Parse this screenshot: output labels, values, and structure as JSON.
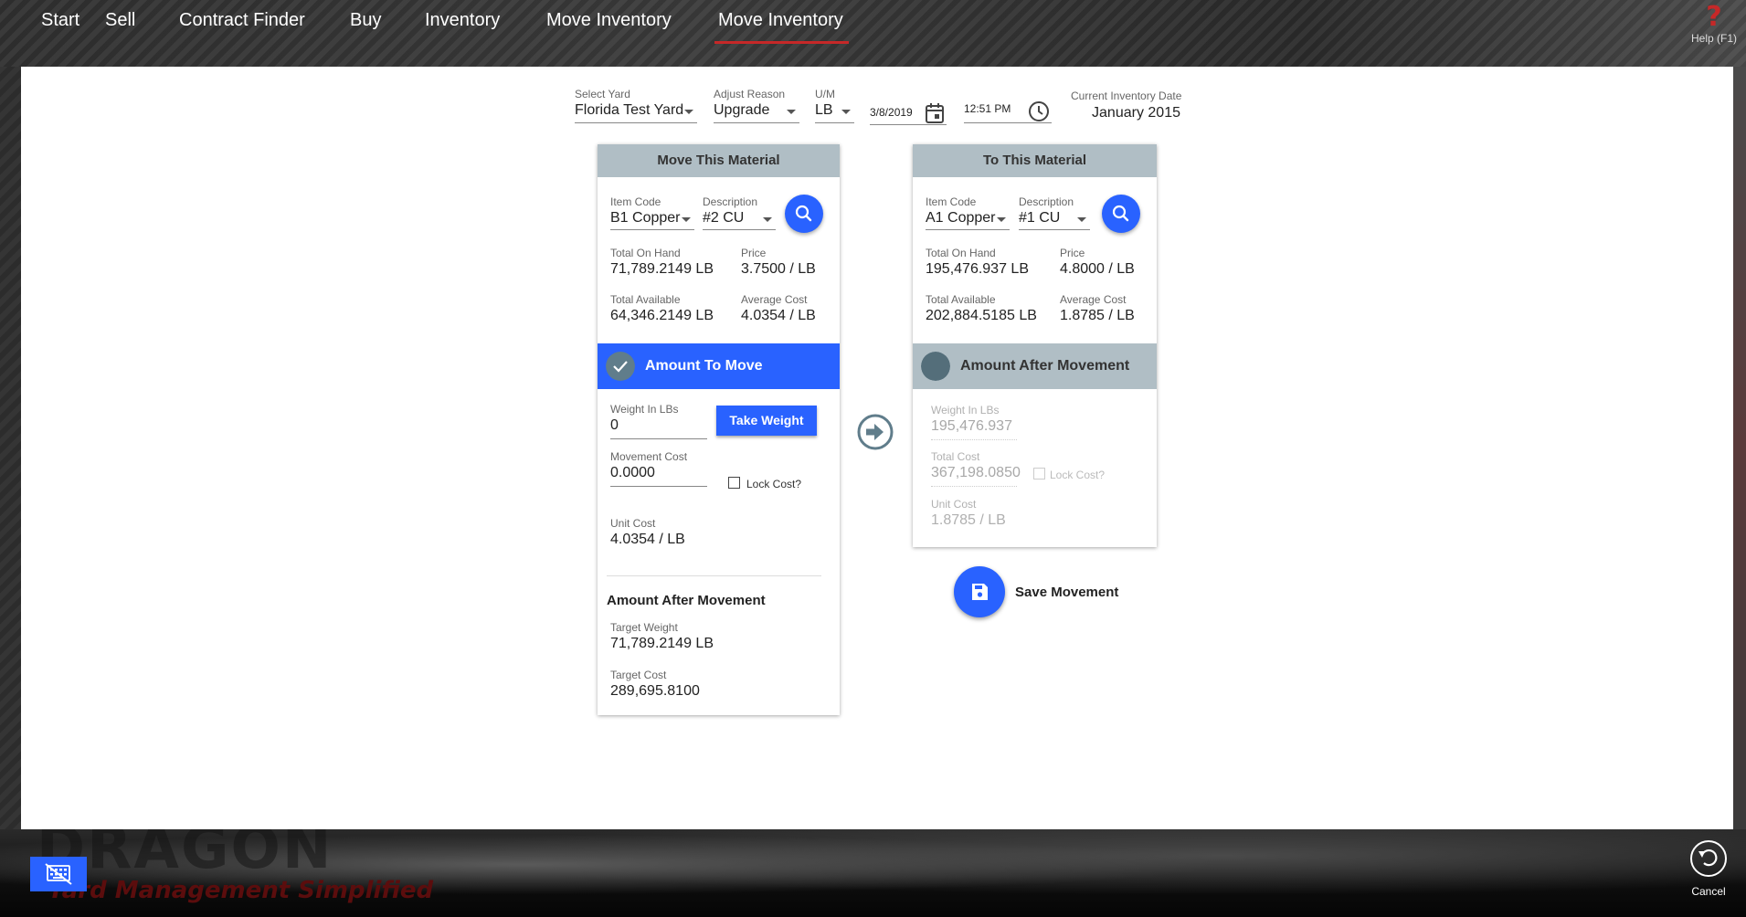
{
  "nav": {
    "items": [
      "Start",
      "Sell",
      "Contract Finder",
      "Buy",
      "Inventory",
      "Move Inventory",
      "Move Inventory"
    ],
    "active_index": 6,
    "help_label": "Help (F1)",
    "help_symbol": "?"
  },
  "header": {
    "yard_label": "Select Yard",
    "yard_value": "Florida Test Yard",
    "reason_label": "Adjust Reason",
    "reason_value": "Upgrade",
    "um_label": "U/M",
    "um_value": "LB",
    "date_value": "3/8/2019",
    "time_value": "12:51 PM",
    "inv_date_label": "Current Inventory Date",
    "inv_date_value": "January 2015"
  },
  "from_card": {
    "title": "Move This Material",
    "item_code_label": "Item Code",
    "item_code_value": "B1 Copper",
    "description_label": "Description",
    "description_value": "#2 CU",
    "total_on_hand_label": "Total On Hand",
    "total_on_hand_value": "71,789.2149 LB",
    "price_label": "Price",
    "price_value": "3.7500 / LB",
    "total_available_label": "Total Available",
    "total_available_value": "64,346.2149 LB",
    "average_cost_label": "Average Cost",
    "average_cost_value": "4.0354 / LB",
    "section_title": "Amount To Move",
    "weight_label": "Weight In LBs",
    "weight_value": "0",
    "take_weight_label": "Take Weight",
    "movement_cost_label": "Movement Cost",
    "movement_cost_value": "0.0000",
    "lock_cost_label": "Lock Cost?",
    "unit_cost_label": "Unit Cost",
    "unit_cost_value": "4.0354 / LB",
    "after_title": "Amount After Movement",
    "target_weight_label": "Target Weight",
    "target_weight_value": "71,789.2149 LB",
    "target_cost_label": "Target Cost",
    "target_cost_value": "289,695.8100"
  },
  "to_card": {
    "title": "To This Material",
    "item_code_label": "Item Code",
    "item_code_value": "A1 Copper",
    "description_label": "Description",
    "description_value": "#1 CU",
    "total_on_hand_label": "Total On Hand",
    "total_on_hand_value": "195,476.937 LB",
    "price_label": "Price",
    "price_value": "4.8000 / LB",
    "total_available_label": "Total Available",
    "total_available_value": "202,884.5185 LB",
    "average_cost_label": "Average Cost",
    "average_cost_value": "1.8785 / LB",
    "section_title": "Amount After Movement",
    "weight_label": "Weight In LBs",
    "weight_value": "195,476.937",
    "total_cost_label": "Total Cost",
    "total_cost_value": "367,198.0850",
    "lock_cost_label": "Lock Cost?",
    "unit_cost_label": "Unit Cost",
    "unit_cost_value": "1.8785 / LB"
  },
  "actions": {
    "save_label": "Save Movement",
    "cancel_label": "Cancel"
  },
  "branding": {
    "logo_text": "DRAGON",
    "tagline": "Yard Management Simplified"
  },
  "colors": {
    "accent": "#2962ff",
    "header_grey": "#b0bec5",
    "active_underline": "#c62828"
  },
  "icons": {
    "search": "search-icon",
    "calendar": "calendar-icon",
    "clock": "clock-icon",
    "check": "check-circle-icon",
    "arrow": "arrow-right-circle-icon",
    "save": "floppy-disk-icon",
    "keyboard": "keyboard-hide-icon",
    "cancel": "undo-circle-icon"
  }
}
